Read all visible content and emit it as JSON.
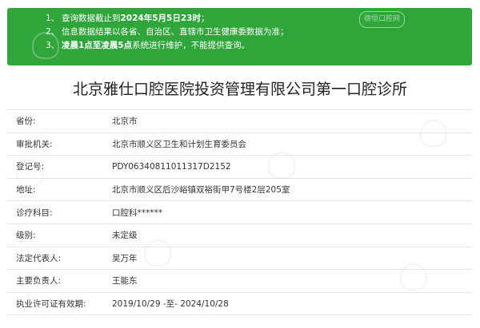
{
  "notice": {
    "lines": [
      {
        "num": "1、",
        "parts": [
          {
            "text": "查询数据截止到",
            "bold": false
          },
          {
            "text": "2024年5月5日23时",
            "bold": true
          },
          {
            "text": "；",
            "bold": false
          }
        ]
      },
      {
        "num": "2、",
        "parts": [
          {
            "text": "信息数据结果以各省、自治区、直辖市卫生健康委数据为准；",
            "bold": false
          }
        ]
      },
      {
        "num": "3、",
        "parts": [
          {
            "text": "凌晨1点至凌晨5点",
            "bold": true
          },
          {
            "text": "系统进行维护，不能提供查询。",
            "bold": false
          }
        ]
      }
    ],
    "watermark": "德恒口腔网"
  },
  "title": "北京雅仕口腔医院投资管理有限公司第一口腔诊所",
  "rows": [
    {
      "label": "省份:",
      "value": "北京市"
    },
    {
      "label": "审批机关:",
      "value": "北京市顺义区卫生和计划生育委员会"
    },
    {
      "label": "登记号:",
      "value": "PDY06340811011317D2152"
    },
    {
      "label": "地址:",
      "value": "北京市顺义区后沙峪镇双裕街甲7号楼2层205室"
    },
    {
      "label": "诊疗科目:",
      "value": "口腔科******"
    },
    {
      "label": "级别:",
      "value": "未定级"
    },
    {
      "label": "法定代表人:",
      "value": "吴万年"
    },
    {
      "label": "主要负责人:",
      "value": "王能东"
    },
    {
      "label": "执业许可证有效期:",
      "value": "2019/10/29 -至- 2024/10/28"
    }
  ],
  "colors": {
    "notice_bg": "#2fa63a",
    "row_border": "#e4e4e4"
  }
}
